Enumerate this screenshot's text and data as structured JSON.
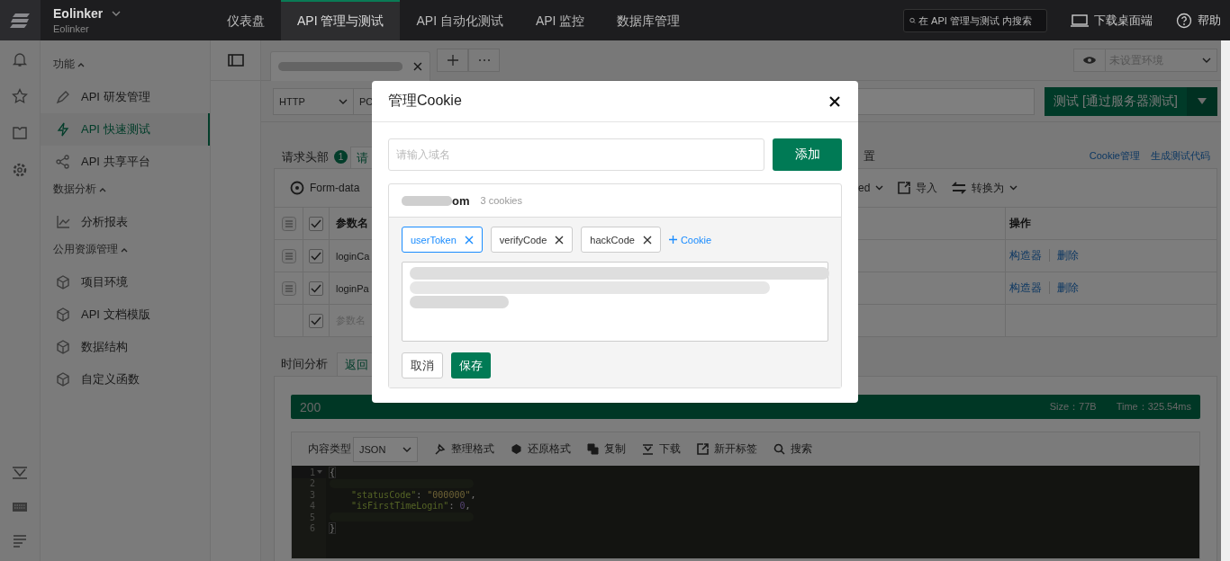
{
  "topbar": {
    "brand": "Eolinker",
    "subtitle": "Eolinker",
    "nav": [
      {
        "label": "仪表盘",
        "selected": false
      },
      {
        "label": "API 管理与测试",
        "selected": true
      },
      {
        "label": "API 自动化测试",
        "selected": false
      },
      {
        "label": "API 监控",
        "selected": false
      },
      {
        "label": "数据库管理",
        "selected": false
      }
    ],
    "search": {
      "placeholder": "在 API 管理与测试 内搜索"
    },
    "download": "下载桌面端",
    "help": "帮助"
  },
  "sidebar": {
    "sections": [
      {
        "title": "功能",
        "expanded": true,
        "items": [
          {
            "label": "API 研发管理",
            "selected": false
          },
          {
            "label": "API 快速测试",
            "selected": true
          },
          {
            "label": "API 共享平台",
            "selected": false
          }
        ]
      },
      {
        "title": "数据分析",
        "expanded": true,
        "items": [
          {
            "label": "分析报表",
            "selected": false
          }
        ]
      },
      {
        "title": "公用资源管理",
        "expanded": true,
        "items": [
          {
            "label": "项目环境",
            "selected": false
          },
          {
            "label": "API 文档模版",
            "selected": false
          },
          {
            "label": "数据结构",
            "selected": false
          },
          {
            "label": "自定义函数",
            "selected": false
          }
        ]
      }
    ]
  },
  "environment": {
    "placeholder": "未设置环境"
  },
  "request": {
    "protocol": "HTTP",
    "method": "PO",
    "send_button": "测试 [通过服务器测试]"
  },
  "params": {
    "tabs": [
      {
        "label": "请求头部",
        "badge": "1",
        "selected": false
      },
      {
        "label": "请",
        "selected": true
      }
    ],
    "cut_label": "置",
    "links": [
      "Cookie管理",
      "生成测试代码"
    ],
    "body_type": {
      "label": "Form-data",
      "selected": true
    },
    "all_checked": true,
    "cut_option": "ed",
    "import": "导入",
    "convert": "转换为",
    "columns": [
      "参数名",
      "操作"
    ],
    "rows": [
      {
        "name": "loginCa",
        "checked": true,
        "actions": [
          "构造器",
          "删除"
        ]
      },
      {
        "name": "loginPa",
        "checked": true,
        "actions": [
          "构造器",
          "删除"
        ]
      },
      {
        "placeholder": "参数名",
        "checked": true
      }
    ]
  },
  "response": {
    "tabs": [
      {
        "label": "时间分析",
        "selected": false
      },
      {
        "label": "返回",
        "selected": true
      }
    ],
    "status": "200",
    "size": "Size：77B",
    "time": "Time：325.54ms",
    "content_type_label": "内容类型",
    "content_type": "JSON",
    "tools": [
      "整理格式",
      "还原格式",
      "复制",
      "下载",
      "新开标签",
      "搜索"
    ],
    "code": [
      {
        "number": "1",
        "foldable": true,
        "tokens": [
          {
            "kind": "punct",
            "text": "{"
          }
        ]
      },
      {
        "number": "2",
        "foldable": false
      },
      {
        "number": "3",
        "foldable": false,
        "tokens": [
          {
            "kind": "key",
            "text": "\"statusCode\""
          },
          {
            "kind": "punct",
            "text": ": "
          },
          {
            "kind": "string",
            "text": "\"000000\""
          },
          {
            "kind": "punct",
            "text": ","
          }
        ]
      },
      {
        "number": "4",
        "foldable": false,
        "tokens": [
          {
            "kind": "key",
            "text": "\"isFirstTimeLogin\""
          },
          {
            "kind": "punct",
            "text": ": "
          },
          {
            "kind": "number",
            "text": "0"
          },
          {
            "kind": "punct",
            "text": ","
          }
        ]
      },
      {
        "number": "5",
        "foldable": false
      },
      {
        "number": "6",
        "foldable": false,
        "tokens": [
          {
            "kind": "punct",
            "text": "}"
          }
        ]
      }
    ]
  },
  "modal": {
    "title": "管理Cookie",
    "domain_input": {
      "placeholder": "请输入域名"
    },
    "add_button": "添加",
    "domain": {
      "visible_text": "om",
      "count": "3 cookies"
    },
    "cookies": [
      {
        "name": "userToken",
        "selected": true
      },
      {
        "name": "verifyCode",
        "selected": false
      },
      {
        "name": "hackCode",
        "selected": false
      }
    ],
    "add_cookie": "Cookie",
    "cancel": "取消",
    "save": "保存"
  }
}
